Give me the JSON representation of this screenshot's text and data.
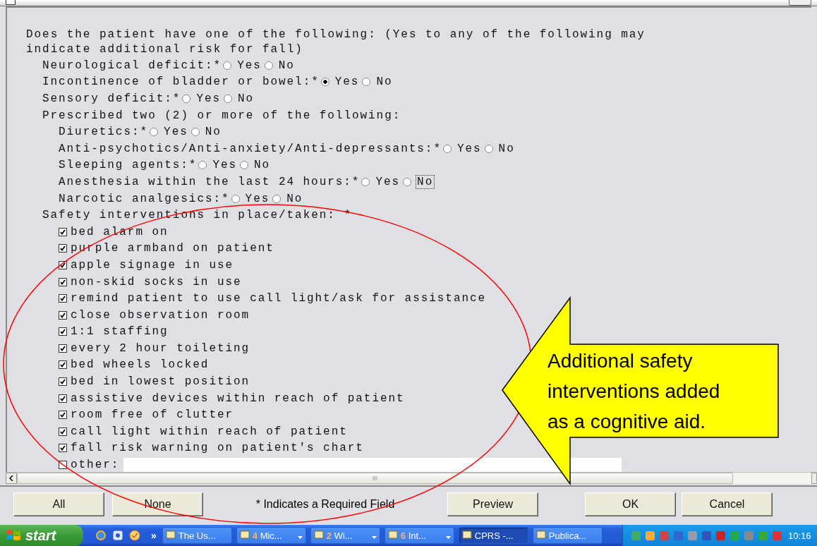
{
  "form": {
    "question": "Does the patient have one of the following: (Yes to any of the following may indicate additional risk for fall)",
    "items": [
      {
        "kind": "radio",
        "label": "Neurological deficit:",
        "required": "*",
        "options": [
          {
            "label": "Yes",
            "selected": false,
            "focused": false
          },
          {
            "label": "No",
            "selected": false,
            "focused": false
          }
        ]
      },
      {
        "kind": "radio",
        "label": "Incontinence of bladder or bowel:",
        "required": "*",
        "options": [
          {
            "label": "Yes",
            "selected": true,
            "focused": false
          },
          {
            "label": "No",
            "selected": false,
            "focused": false
          }
        ]
      },
      {
        "kind": "radio",
        "label": "Sensory deficit:",
        "required": "*",
        "options": [
          {
            "label": "Yes",
            "selected": false,
            "focused": false
          },
          {
            "label": "No",
            "selected": false,
            "focused": false
          }
        ]
      },
      {
        "kind": "group",
        "label": "Prescribed two (2) or more of the following:",
        "children": [
          {
            "kind": "radio",
            "label": "Diuretics:",
            "required": "*",
            "options": [
              {
                "label": "Yes",
                "selected": false,
                "focused": false
              },
              {
                "label": "No",
                "selected": false,
                "focused": false
              }
            ]
          },
          {
            "kind": "radio",
            "label": "Anti-psychotics/Anti-anxiety/Anti-depressants:",
            "required": "*",
            "options": [
              {
                "label": "Yes",
                "selected": false,
                "focused": false
              },
              {
                "label": "No",
                "selected": false,
                "focused": false
              }
            ]
          },
          {
            "kind": "radio",
            "label": "Sleeping agents:",
            "required": "*",
            "options": [
              {
                "label": "Yes",
                "selected": false,
                "focused": false
              },
              {
                "label": "No",
                "selected": false,
                "focused": false
              }
            ]
          },
          {
            "kind": "radio",
            "label": "Anesthesia within the last 24 hours:",
            "required": "*",
            "options": [
              {
                "label": "Yes",
                "selected": false,
                "focused": false
              },
              {
                "label": "No",
                "selected": false,
                "focused": true
              }
            ]
          },
          {
            "kind": "radio",
            "label": "Narcotic analgesics:",
            "required": "*",
            "options": [
              {
                "label": "Yes",
                "selected": false,
                "focused": false
              },
              {
                "label": "No",
                "selected": false,
                "focused": false
              }
            ]
          }
        ]
      }
    ],
    "safety": {
      "label": "Safety interventions in place/taken: *",
      "checkboxes": [
        {
          "label": "bed alarm on",
          "checked": true
        },
        {
          "label": "purple armband on patient",
          "checked": true
        },
        {
          "label": "apple signage in use",
          "checked": true
        },
        {
          "label": "non-skid socks in use",
          "checked": true
        },
        {
          "label": "remind patient to use call light/ask for assistance",
          "checked": true
        },
        {
          "label": "close observation room",
          "checked": true
        },
        {
          "label": "1:1 staffing",
          "checked": true
        },
        {
          "label": "every 2 hour toileting",
          "checked": true
        },
        {
          "label": "bed wheels locked",
          "checked": true
        },
        {
          "label": "bed in lowest position",
          "checked": true
        },
        {
          "label": "assistive devices within reach of patient",
          "checked": true
        },
        {
          "label": "room free of clutter",
          "checked": true
        },
        {
          "label": "call light within reach of patient",
          "checked": true
        },
        {
          "label": "fall risk warning on patient's chart",
          "checked": true
        }
      ],
      "other": {
        "label": "other:",
        "checked": false
      }
    }
  },
  "footer": [
    {
      "kind": "button",
      "label": "All"
    },
    {
      "kind": "button",
      "label": "None"
    },
    {
      "kind": "note",
      "label": "* Indicates a Required Field"
    },
    {
      "kind": "button",
      "label": "Preview"
    },
    {
      "kind": "button",
      "label": "OK"
    },
    {
      "kind": "button",
      "label": "Cancel"
    }
  ],
  "taskbar": {
    "start": "start",
    "more": "»",
    "tasks": [
      {
        "label": "The Us...",
        "grouped": false,
        "selected": false
      },
      {
        "count": "4",
        "label": "Mic...",
        "grouped": true,
        "selected": false
      },
      {
        "count": "2",
        "label": "Wi...",
        "grouped": true,
        "selected": false
      },
      {
        "count": "6",
        "label": "Int...",
        "grouped": true,
        "selected": false
      },
      {
        "label": "CPRS -...",
        "grouped": false,
        "selected": true
      },
      {
        "label": "Publica...",
        "grouped": false,
        "selected": false
      }
    ],
    "clock": "10:16"
  },
  "annotation": {
    "text": "Additional safety interventions added as a cognitive aid."
  }
}
